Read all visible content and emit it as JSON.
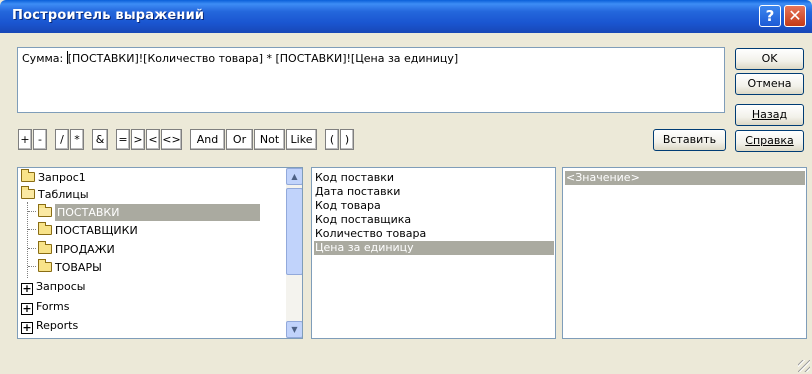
{
  "window": {
    "title": "Построитель выражений",
    "help_label": "?",
    "close_label": "✕"
  },
  "expression": {
    "prefix": "Сумма: ",
    "value": "[ПОСТАВКИ]![Количество товара] * [ПОСТАВКИ]![Цена за единицу]"
  },
  "buttons": {
    "ok": "OK",
    "cancel": "Отмена",
    "back": "Назад",
    "help": "Справка",
    "insert": "Вставить"
  },
  "operators": [
    "+",
    "-",
    "/",
    "*",
    "&",
    "=",
    ">",
    "<",
    "<>",
    "And",
    "Or",
    "Not",
    "Like",
    "(",
    ")"
  ],
  "tree": {
    "items": [
      {
        "label": "Запрос1",
        "icon": "folder-icon"
      },
      {
        "label": "Таблицы",
        "icon": "folder-open-icon"
      },
      {
        "label": "ПОСТАВКИ",
        "icon": "folder-open-icon",
        "selected": true
      },
      {
        "label": "ПОСТАВЩИКИ",
        "icon": "folder-icon"
      },
      {
        "label": "ПРОДАЖИ",
        "icon": "folder-icon"
      },
      {
        "label": "ТОВАРЫ",
        "icon": "folder-icon"
      },
      {
        "label": "Запросы",
        "icon": "plus-box-icon"
      },
      {
        "label": "Forms",
        "icon": "plus-box-icon"
      },
      {
        "label": "Reports",
        "icon": "plus-box-icon"
      }
    ]
  },
  "fields": {
    "items": [
      "Код поставки",
      "Дата поставки",
      "Код товара",
      "Код поставщика",
      "Количество товара",
      "Цена за единицу"
    ],
    "selected_index": 5
  },
  "values": {
    "items": [
      "<Значение>"
    ]
  },
  "colors": {
    "titlebar": "#2467dc",
    "selection_active": "#316ac5",
    "selection_inactive": "#aaaaa0",
    "dialog_bg": "#ece9d8"
  }
}
